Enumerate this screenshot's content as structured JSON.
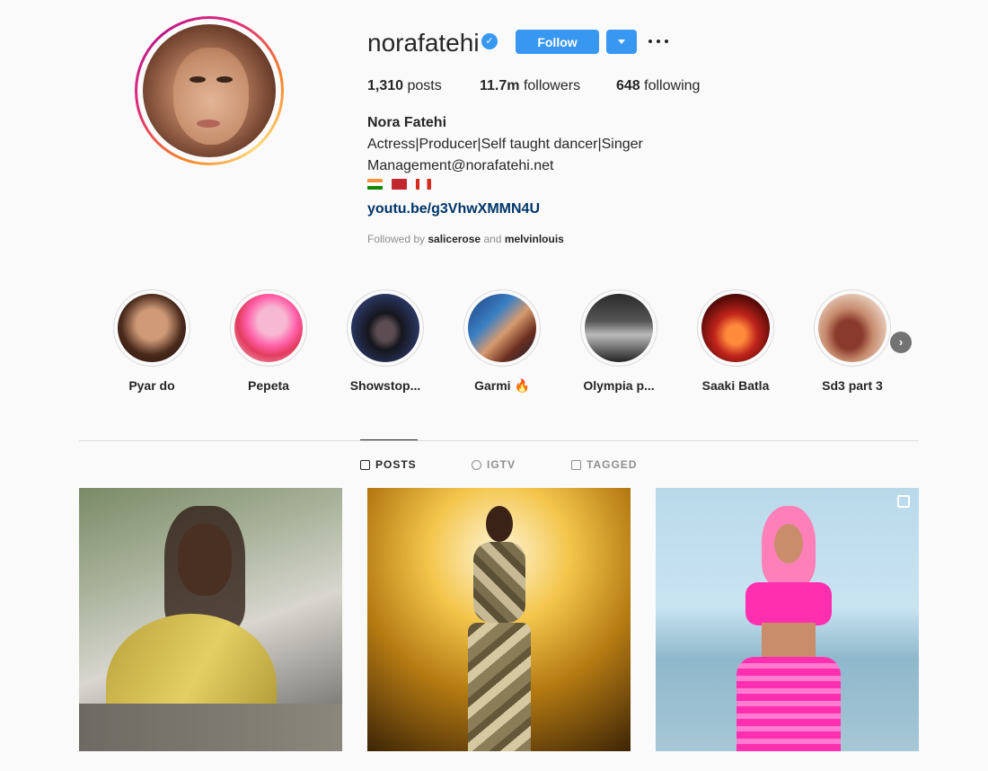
{
  "profile": {
    "username": "norafatehi",
    "verified_badge": "✓",
    "follow_label": "Follow",
    "stats": {
      "posts_count": "1,310",
      "posts_label": "posts",
      "followers_count": "11.7m",
      "followers_label": "followers",
      "following_count": "648",
      "following_label": "following"
    },
    "full_name": "Nora Fatehi",
    "bio_line1": "Actress|Producer|Self taught dancer|Singer",
    "bio_line2": "Management@norafatehi.net",
    "flags": [
      "india-flag",
      "morocco-flag",
      "canada-flag"
    ],
    "link": "youtu.be/g3VhwXMMN4U",
    "followed_by_prefix": "Followed by",
    "followed_by_user1": "salicerose",
    "followed_by_and": "and",
    "followed_by_user2": "melvinlouis"
  },
  "highlights": [
    {
      "label": "Pyar do"
    },
    {
      "label": "Pepeta"
    },
    {
      "label": "Showstop..."
    },
    {
      "label": "Garmi 🔥"
    },
    {
      "label": "Olympia p..."
    },
    {
      "label": "Saaki Batla"
    },
    {
      "label": "Sd3 part 3"
    }
  ],
  "tabs": [
    {
      "label": "POSTS",
      "icon": "grid-icon"
    },
    {
      "label": "IGTV",
      "icon": "igtv-icon"
    },
    {
      "label": "TAGGED",
      "icon": "tag-icon"
    }
  ],
  "colors": {
    "accent": "#3897f0",
    "link": "#003569",
    "muted": "#8e8e8e",
    "text": "#262626"
  }
}
